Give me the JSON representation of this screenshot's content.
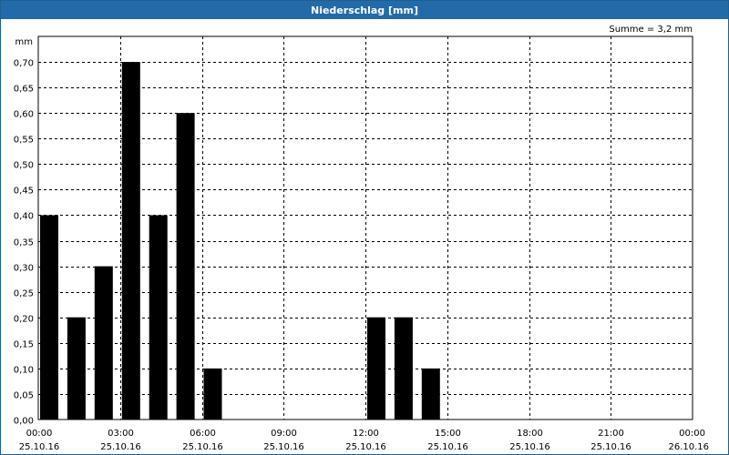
{
  "window": {
    "title": "Niederschlag [mm]"
  },
  "chart_data": {
    "type": "bar",
    "title": "Niederschlag [mm]",
    "ylabel": "mm",
    "ylim": [
      0,
      0.75
    ],
    "annotation": "Summe = 3,2 mm",
    "bar_color": "#000000",
    "grid": "dashed",
    "y_ticks": [
      0,
      0.05,
      0.1,
      0.15,
      0.2,
      0.25,
      0.3,
      0.35,
      0.4,
      0.45,
      0.5,
      0.55,
      0.6,
      0.65,
      0.7
    ],
    "y_tick_labels": [
      "0,00",
      "0,05",
      "0,10",
      "0,15",
      "0,20",
      "0,25",
      "0,30",
      "0,35",
      "0,40",
      "0,45",
      "0,50",
      "0,55",
      "0,60",
      "0,65",
      "0,70"
    ],
    "x_ticks": [
      {
        "hour": 0,
        "time": "00:00",
        "date": "25.10.16"
      },
      {
        "hour": 3,
        "time": "03:00",
        "date": "25.10.16"
      },
      {
        "hour": 6,
        "time": "06:00",
        "date": "25.10.16"
      },
      {
        "hour": 9,
        "time": "09:00",
        "date": "25.10.16"
      },
      {
        "hour": 12,
        "time": "12:00",
        "date": "25.10.16"
      },
      {
        "hour": 15,
        "time": "15:00",
        "date": "25.10.16"
      },
      {
        "hour": 18,
        "time": "18:00",
        "date": "25.10.16"
      },
      {
        "hour": 21,
        "time": "21:00",
        "date": "25.10.16"
      },
      {
        "hour": 24,
        "time": "00:00",
        "date": "26.10.16"
      }
    ],
    "series": [
      {
        "values": [
          {
            "hour": 0,
            "value": 0.4
          },
          {
            "hour": 1,
            "value": 0.2
          },
          {
            "hour": 2,
            "value": 0.3
          },
          {
            "hour": 3,
            "value": 0.7
          },
          {
            "hour": 4,
            "value": 0.4
          },
          {
            "hour": 5,
            "value": 0.6
          },
          {
            "hour": 6,
            "value": 0.1
          },
          {
            "hour": 12,
            "value": 0.2
          },
          {
            "hour": 13,
            "value": 0.2
          },
          {
            "hour": 14,
            "value": 0.1
          }
        ]
      }
    ]
  }
}
